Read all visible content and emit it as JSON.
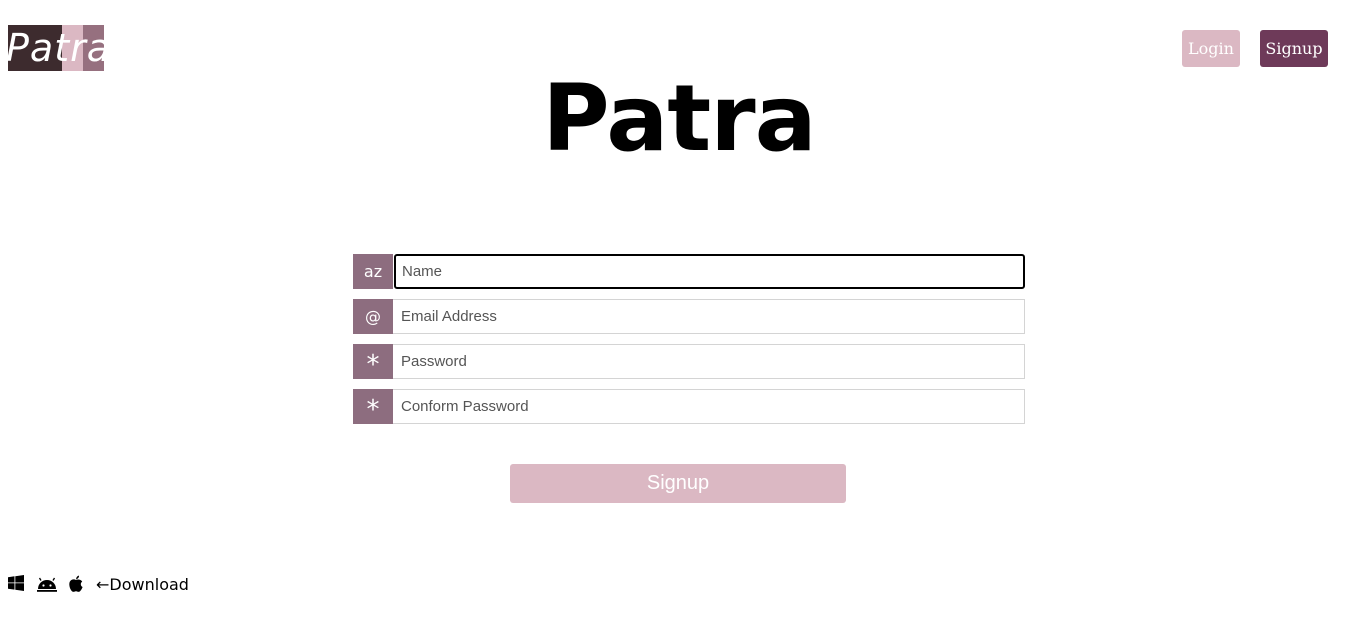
{
  "logo": {
    "text": "Patra",
    "colors": [
      "#3d2b2e",
      "#dbb8c3",
      "#96707f"
    ]
  },
  "header": {
    "login_label": "Login",
    "signup_label": "Signup"
  },
  "main": {
    "title": "Patra"
  },
  "form": {
    "name": {
      "addon": "az",
      "placeholder": "Name"
    },
    "email": {
      "addon": "@",
      "placeholder": "Email Address"
    },
    "password": {
      "addon": "*",
      "placeholder": "Password"
    },
    "confirm": {
      "addon": "*",
      "placeholder": "Conform Password"
    },
    "submit_label": "Signup"
  },
  "footer": {
    "icons": [
      "windows-icon",
      "android-icon",
      "apple-icon"
    ],
    "download_label": "←Download"
  },
  "colors": {
    "accent_dark": "#6e3a59",
    "accent_light": "#dbb8c3",
    "addon": "#8d6d7f"
  }
}
